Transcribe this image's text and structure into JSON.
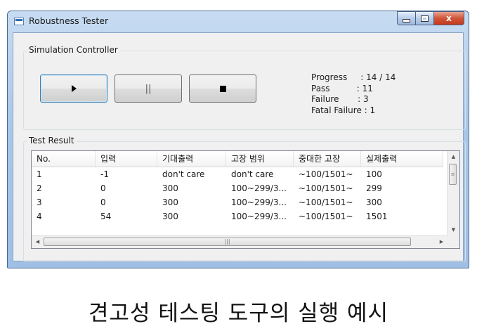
{
  "window": {
    "title": "Robustness Tester",
    "icons": {
      "app": "window-app-icon",
      "minimize": "minimize-icon",
      "maximize": "maximize-icon",
      "close": "close-icon"
    },
    "close_glyph": "x"
  },
  "simulation": {
    "group_label": "Simulation Controller",
    "buttons": {
      "play_icon": "play-icon",
      "pause_label": "||",
      "stop_icon": "stop-icon"
    },
    "stats": [
      {
        "label": "Progress",
        "sep": "     : ",
        "value": "14 / 14"
      },
      {
        "label": "Pass",
        "sep": "          : ",
        "value": "11"
      },
      {
        "label": "Failure",
        "sep": "       : ",
        "value": "3"
      },
      {
        "label": "Fatal Failure",
        "sep": " : ",
        "value": "1"
      }
    ]
  },
  "results": {
    "group_label": "Test Result",
    "columns": [
      "No.",
      "입력",
      "기대출력",
      "고장 범위",
      "중대한 고장",
      "실제출력"
    ],
    "rows": [
      [
        "1",
        "-1",
        "don't care",
        "don't care",
        "~100/1501~",
        "100"
      ],
      [
        "2",
        "0",
        "300",
        "100~299/3...",
        "~100/1501~",
        "299"
      ],
      [
        "3",
        "0",
        "300",
        "100~299/3...",
        "~100/1501~",
        "300"
      ],
      [
        "4",
        "54",
        "300",
        "100~299/3...",
        "~100/1501~",
        "1501"
      ]
    ],
    "scroll": {
      "up": "▲",
      "down": "▼",
      "left": "◀",
      "right": "▶",
      "v_grip": "≡",
      "h_grip": "|||"
    }
  },
  "caption": "견고성 테스팅 도구의 실행 예시"
}
